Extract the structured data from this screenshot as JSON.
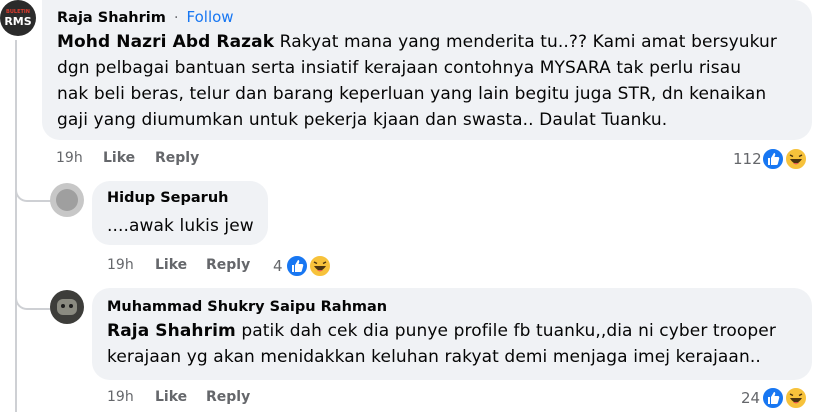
{
  "top_comment": {
    "author": "Raja Shahrim",
    "separator": "·",
    "follow_label": "Follow",
    "mention": "Mohd Nazri Abd Razak",
    "lines": [
      " Rakyat mana yang menderita tu..?? Kami amat bersyukur",
      "dgn pelbagai bantuan serta insiatif kerajaan contohnya MYSARA tak perlu risau",
      "nak beli beras, telur dan barang keperluan yang lain begitu juga STR, dn kenaikan",
      "gaji yang diumumkan untuk pekerja kjaan dan swasta.. Daulat Tuanku."
    ],
    "time": "19h",
    "like_label": "Like",
    "reply_label": "Reply",
    "reaction_count": "112",
    "avatar_text_top": "BULETIN",
    "avatar_text_bottom": "RMS"
  },
  "reply1": {
    "author": "Hidup Separuh",
    "text": "....awak lukis jew",
    "time": "19h",
    "like_label": "Like",
    "reply_label": "Reply",
    "reaction_count": "4"
  },
  "reply2": {
    "author": "Muhammad Shukry Saipu Rahman",
    "mention": "Raja Shahrim",
    "lines": [
      " patik dah cek dia punye profile fb tuanku,,dia ni cyber trooper",
      "kerajaan yg akan menidakkan keluhan rakyat demi menjaga imej kerajaan.."
    ],
    "time": "19h",
    "like_label": "Like",
    "reply_label": "Reply",
    "reaction_count": "24"
  },
  "colors": {
    "bubble": "#f0f2f5",
    "follow": "#1877f2",
    "like": "#1877f2",
    "haha": "#f7c23b",
    "meta": "#65676b"
  }
}
